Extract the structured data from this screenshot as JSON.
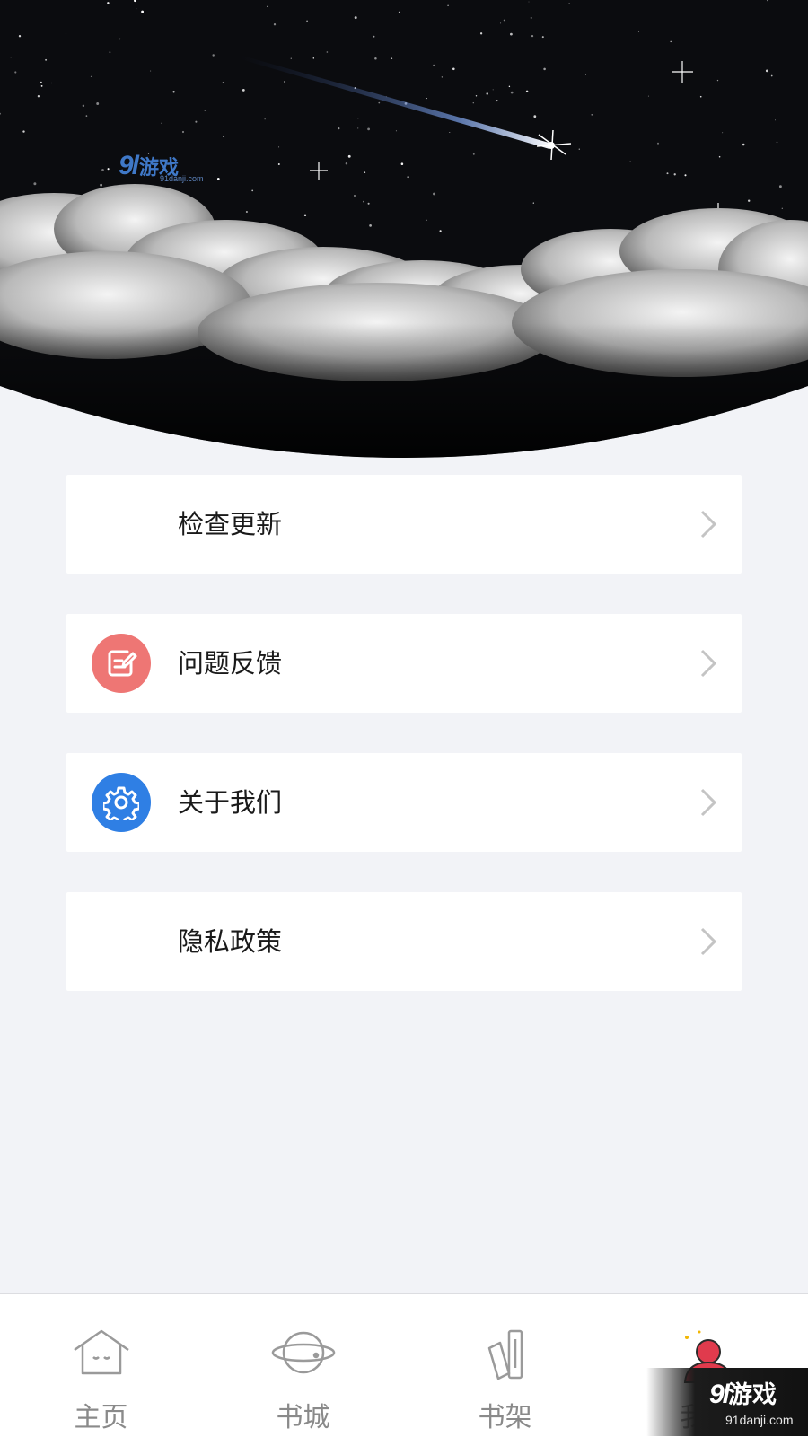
{
  "watermark": {
    "logo": "9l",
    "brand": "游戏",
    "url": "91danji.com"
  },
  "menu": [
    {
      "label": "检查更新",
      "icon": "none"
    },
    {
      "label": "问题反馈",
      "icon": "edit-note-icon"
    },
    {
      "label": "关于我们",
      "icon": "gear-icon"
    },
    {
      "label": "隐私政策",
      "icon": "none"
    }
  ],
  "tabs": [
    {
      "label": "主页",
      "icon": "home-icon",
      "active": false
    },
    {
      "label": "书城",
      "icon": "planet-icon",
      "active": false
    },
    {
      "label": "书架",
      "icon": "bookshelf-icon",
      "active": false
    },
    {
      "label": "我的",
      "icon": "user-icon",
      "active": true
    }
  ],
  "colors": {
    "page_bg": "#f2f3f7",
    "feedback_icon_bg": "#ee7674",
    "about_icon_bg": "#2f7fe4",
    "active_tab": "#e03b4d",
    "tab_inactive": "#8a8a8a"
  }
}
